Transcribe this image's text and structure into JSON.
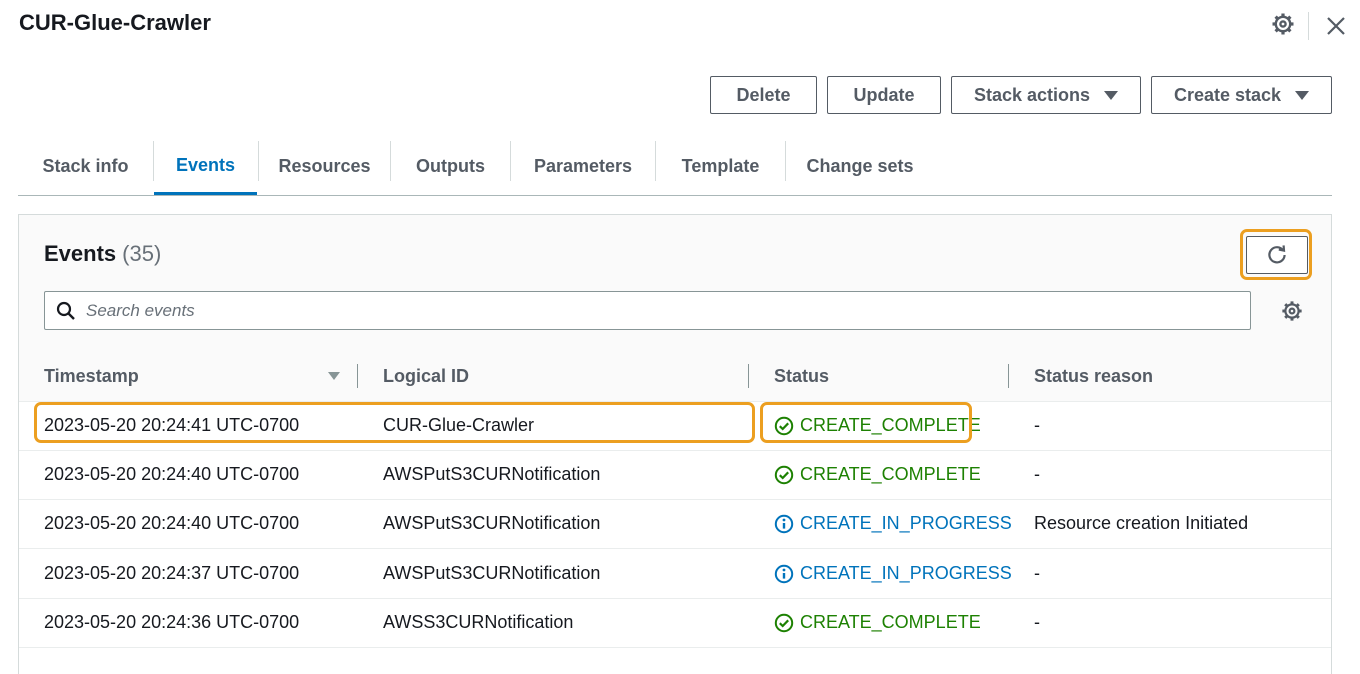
{
  "header": {
    "title": "CUR-Glue-Crawler",
    "icons": [
      "gear-icon",
      "close-icon"
    ]
  },
  "actions": {
    "delete_label": "Delete",
    "update_label": "Update",
    "stack_actions_label": "Stack actions",
    "create_stack_label": "Create stack"
  },
  "tabs": [
    {
      "label": "Stack info",
      "active": false
    },
    {
      "label": "Events",
      "active": true
    },
    {
      "label": "Resources",
      "active": false
    },
    {
      "label": "Outputs",
      "active": false
    },
    {
      "label": "Parameters",
      "active": false
    },
    {
      "label": "Template",
      "active": false
    },
    {
      "label": "Change sets",
      "active": false
    }
  ],
  "events": {
    "title": "Events",
    "count": "(35)",
    "search_placeholder": "Search events",
    "columns": [
      "Timestamp",
      "Logical ID",
      "Status",
      "Status reason"
    ],
    "rows": [
      {
        "timestamp": "2023-05-20 20:24:41 UTC-0700",
        "logical_id": "CUR-Glue-Crawler",
        "status": "CREATE_COMPLETE",
        "status_type": "complete",
        "reason": "-"
      },
      {
        "timestamp": "2023-05-20 20:24:40 UTC-0700",
        "logical_id": "AWSPutS3CURNotification",
        "status": "CREATE_COMPLETE",
        "status_type": "complete",
        "reason": "-"
      },
      {
        "timestamp": "2023-05-20 20:24:40 UTC-0700",
        "logical_id": "AWSPutS3CURNotification",
        "status": "CREATE_IN_PROGRESS",
        "status_type": "progress",
        "reason": "Resource creation Initiated"
      },
      {
        "timestamp": "2023-05-20 20:24:37 UTC-0700",
        "logical_id": "AWSPutS3CURNotification",
        "status": "CREATE_IN_PROGRESS",
        "status_type": "progress",
        "reason": "-"
      },
      {
        "timestamp": "2023-05-20 20:24:36 UTC-0700",
        "logical_id": "AWSS3CURNotification",
        "status": "CREATE_COMPLETE",
        "status_type": "complete",
        "reason": "-"
      }
    ]
  },
  "colors": {
    "accent": "#0073bb",
    "success": "#1d8102",
    "highlight": "#ec9f20"
  }
}
